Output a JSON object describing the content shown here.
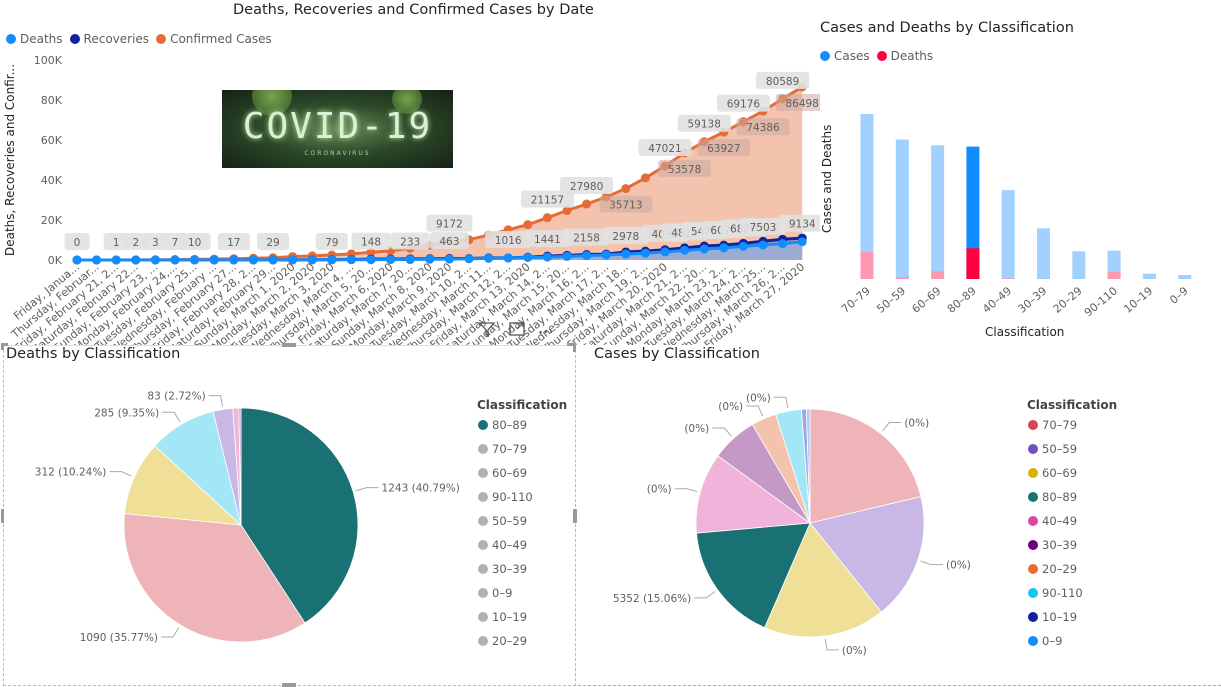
{
  "line_chart": {
    "title": "Deaths, Recoveries and Confirmed Cases by Date",
    "ylabel": "Deaths, Recoveries and Confir...",
    "image_text": "COVID-19",
    "image_subtext": "CORONAVIRUS",
    "legend": [
      {
        "name": "Deaths",
        "color": "#118DFF"
      },
      {
        "name": "Recoveries",
        "color": "#12239E"
      },
      {
        "name": "Confirmed Cases",
        "color": "#E66C37"
      }
    ],
    "icons": [
      "filter-icon",
      "focus-mode-icon",
      "more-options-icon"
    ]
  },
  "chart_data": [
    {
      "type": "line",
      "title": "Deaths, Recoveries and Confirmed Cases by Date",
      "ylabel": "Deaths, Recoveries and Confir...",
      "ylim": [
        0,
        100000
      ],
      "yticks": [
        "0K",
        "20K",
        "40K",
        "60K",
        "80K",
        "100K"
      ],
      "grid": false,
      "legend_position": "top-left",
      "x_ticklabels": [
        "Friday, Janua...",
        "Thursday, Februar...",
        "Friday, February 21, 2...",
        "Saturday, February 22...",
        "Sunday, February 23, ...",
        "Monday, February 24,...",
        "Tuesday, February 25...",
        "Wednesday, February ...",
        "Thursday, February 27...",
        "Friday, February 28, 2...",
        "Saturday, February 29...",
        "Sunday, March 1, 2020",
        "Monday, March 2, 2020",
        "Tuesday, March 3, 2020",
        "Wednesday, March 4, ...",
        "Thursday, March 5, 20...",
        "Friday, March 6, 2020",
        "Saturday, March 7, 20...",
        "Sunday, March 8, 2020",
        "Monday, March 9, 2020",
        "Tuesday, March 10, 2...",
        "Wednesday, March 11...",
        "Thursday, March 12, 2...",
        "Friday, March 13, 2020",
        "Saturday, March 14, 2...",
        "Sunday, March 15, 20...",
        "Monday, March 16, 2...",
        "Tuesday, March 17, 2...",
        "Wednesday, March 18...",
        "Thursday, March 19, 2...",
        "Friday, March 20, 2020",
        "Saturday, March 21, 2...",
        "Sunday, March 22, 20...",
        "Monday, March 23, 2...",
        "Tuesday, March 24, 2...",
        "Wednesday, March 25...",
        "Thursday, March 26, 2...",
        "Friday, March 27, 2020"
      ],
      "series": [
        {
          "name": "Confirmed Cases",
          "color": "#E66C37",
          "values": [
            2,
            3,
            20,
            62,
            155,
            229,
            322,
            453,
            655,
            888,
            1128,
            1694,
            2036,
            2502,
            3089,
            3858,
            4636,
            5883,
            7375,
            9172,
            10149,
            12462,
            15113,
            17660,
            21157,
            24747,
            27980,
            31506,
            35713,
            41035,
            47021,
            53578,
            59138,
            63927,
            69176,
            74386,
            80589,
            86498
          ],
          "labeled": [
            19,
            24,
            26,
            28,
            30,
            31,
            32,
            33,
            34,
            35,
            36,
            37
          ]
        },
        {
          "name": "Recoveries",
          "color": "#12239E",
          "values": [
            0,
            0,
            0,
            1,
            2,
            1,
            1,
            3,
            45,
            46,
            46,
            83,
            149,
            160,
            276,
            414,
            523,
            589,
            622,
            724,
            724,
            1045,
            1045,
            1439,
            1966,
            2335,
            2749,
            2941,
            4025,
            4440,
            5129,
            6072,
            7024,
            7432,
            8326,
            9362,
            10361,
            10950
          ],
          "labeled": []
        },
        {
          "name": "Deaths",
          "color": "#118DFF",
          "values": [
            0,
            0,
            1,
            2,
            3,
            7,
            10,
            12,
            17,
            21,
            29,
            34,
            52,
            79,
            107,
            148,
            197,
            233,
            366,
            463,
            631,
            827,
            1016,
            1266,
            1441,
            1809,
            2158,
            2503,
            2978,
            3405,
            4032,
            4825,
            5476,
            6077,
            6820,
            7503,
            8165,
            9134
          ],
          "labeled": [
            0,
            2,
            3,
            4,
            5,
            6,
            8,
            10,
            13,
            15,
            17,
            19,
            22,
            24,
            26,
            28,
            30,
            31,
            32,
            33,
            34,
            35,
            37
          ]
        }
      ]
    },
    {
      "type": "bar",
      "title": "Cases and Deaths by Classification",
      "xlabel": "Classification",
      "ylabel": "Cases and Deaths",
      "legend_position": "top-left",
      "highlighted": "80–89",
      "categories": [
        "70–79",
        "50–59",
        "60–69",
        "80–89",
        "40–49",
        "30–39",
        "20–29",
        "90-110",
        "10–19",
        "0–9"
      ],
      "series": [
        {
          "name": "Cases",
          "color": "#118DFF",
          "faded_color": "#A0D1FF",
          "values": [
            6670,
            5640,
            5405,
            5352,
            3590,
            2050,
            1120,
            1145,
            215,
            160
          ]
        },
        {
          "name": "Deaths",
          "color": "#FF0040",
          "faded_color": "#FF99B3",
          "values": [
            1090,
            83,
            312,
            1243,
            25,
            9,
            1,
            285,
            1,
            1
          ]
        }
      ]
    },
    {
      "type": "pie",
      "title": "Deaths by Classification",
      "legend_title": "Classification",
      "legend_position": "right",
      "legend_order": [
        "80–89",
        "70–79",
        "60–69",
        "90-110",
        "50–59",
        "40–49",
        "30–39",
        "0–9",
        "10–19",
        "20–29"
      ],
      "highlighted": "80–89",
      "slices": [
        {
          "label": "80–89",
          "value": 1243,
          "data_label": "1243 (40.79%)",
          "color": "#1A7174"
        },
        {
          "label": "70–79",
          "value": 1090,
          "data_label": "1090 (35.77%)",
          "color": "#EEB4B8"
        },
        {
          "label": "60–69",
          "value": 312,
          "data_label": "312 (10.24%)",
          "color": "#EFDF97"
        },
        {
          "label": "90-110",
          "value": 285,
          "data_label": "285 (9.35%)",
          "color": "#A3E7F7"
        },
        {
          "label": "50–59",
          "value": 83,
          "data_label": "83 (2.72%)",
          "color": "#C9B8E6"
        },
        {
          "label": "40–49",
          "value": 25,
          "data_label": "",
          "color": "#F0B4DB"
        },
        {
          "label": "30–39",
          "value": 9,
          "data_label": "",
          "color": "#C499C7"
        }
      ]
    },
    {
      "type": "pie",
      "title": "Cases by Classification",
      "legend_title": "Classification",
      "legend_position": "right",
      "slices": [
        {
          "label": "70–79",
          "value": 6670,
          "data_label": "(0%)",
          "color": "#EEB4B8",
          "legend_color": "#D64550"
        },
        {
          "label": "50–59",
          "value": 5640,
          "data_label": "(0%)",
          "color": "#C9B8E6",
          "legend_color": "#744EC2"
        },
        {
          "label": "60–69",
          "value": 5405,
          "data_label": "(0%)",
          "color": "#EFDF97",
          "legend_color": "#D9B300"
        },
        {
          "label": "80–89",
          "value": 5352,
          "data_label": "5352 (15.06%)",
          "color": "#1A7174",
          "legend_color": "#1A7174"
        },
        {
          "label": "40–49",
          "value": 3590,
          "data_label": "(0%)",
          "color": "#F0B4DB",
          "legend_color": "#E044A7"
        },
        {
          "label": "30–39",
          "value": 2050,
          "data_label": "(0%)",
          "color": "#C499C7",
          "legend_color": "#6B007B"
        },
        {
          "label": "20–29",
          "value": 1120,
          "data_label": "(0%)",
          "color": "#F4C3AE",
          "legend_color": "#E66C37"
        },
        {
          "label": "90-110",
          "value": 1145,
          "data_label": "(0%)",
          "color": "#A3E7F7",
          "legend_color": "#15C6F4"
        },
        {
          "label": "10–19",
          "value": 215,
          "data_label": "",
          "color": "#9EA8DC",
          "legend_color": "#12239E"
        },
        {
          "label": "0–9",
          "value": 160,
          "data_label": "",
          "color": "#A6CCF7",
          "legend_color": "#118DFF"
        }
      ]
    }
  ]
}
